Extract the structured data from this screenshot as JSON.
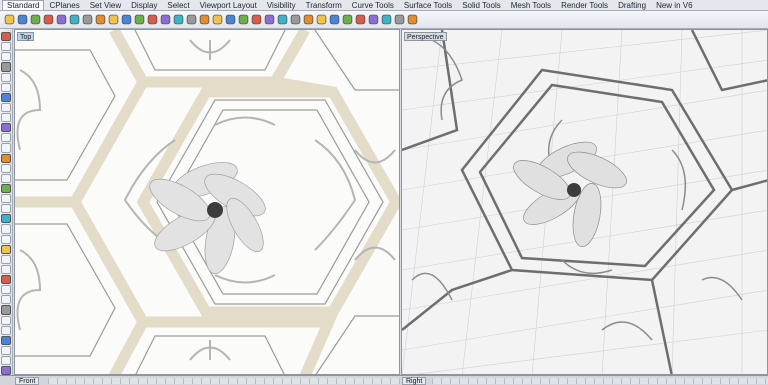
{
  "tabs": [
    "Standard",
    "CPlanes",
    "Set View",
    "Display",
    "Select",
    "Viewport Layout",
    "Visibility",
    "Transform",
    "Curve Tools",
    "Surface Tools",
    "Solid Tools",
    "Mesh Tools",
    "Render Tools",
    "Drafting",
    "New in V6"
  ],
  "active_tab": "Standard",
  "toolbar_icons": [
    "new-file-icon",
    "open-file-icon",
    "save-icon",
    "print-icon",
    "import-icon",
    "cut-icon",
    "copy-icon",
    "paste-icon",
    "undo-icon",
    "redo-icon",
    "pan-icon",
    "rotate-view-icon",
    "zoom-icon",
    "zoom-window-icon",
    "zoom-extents-icon",
    "zoom-selected-icon",
    "select-icon",
    "set-view-icon",
    "viewport-icon",
    "cplane-icon",
    "grid-icon",
    "snap-icon",
    "lock-icon",
    "layer-icon",
    "properties-icon",
    "material-icon",
    "display-icon",
    "shaded-icon",
    "rendered-icon",
    "render-icon",
    "options-icon",
    "help-icon"
  ],
  "left_icons": [
    "point-icon",
    "line-icon",
    "polyline-icon",
    "curve-icon",
    "circle-icon",
    "arc-icon",
    "ellipse-icon",
    "rectangle-icon",
    "polygon-icon",
    "text-icon",
    "surface-icon",
    "extrude-icon",
    "box-icon",
    "sphere-icon",
    "cylinder-icon",
    "mesh-icon",
    "fillet-icon",
    "trim-icon",
    "split-icon",
    "join-icon",
    "explode-icon",
    "move-icon",
    "copy-obj-icon",
    "rotate-icon",
    "scale-icon",
    "mirror-icon",
    "array-icon",
    "boolean-icon",
    "dimension-icon",
    "hatch-icon",
    "block-icon",
    "group-icon",
    "hide-icon",
    "lock-obj-icon"
  ],
  "viewports": {
    "top": {
      "label": "Top"
    },
    "perspective": {
      "label": "Perspective"
    }
  },
  "bottom_tabs": {
    "left": "Front",
    "right": "Right"
  },
  "colors": {
    "accent": "#bcd3ee",
    "beige_band": "#e3dcc8",
    "background": "#d9dde3"
  }
}
